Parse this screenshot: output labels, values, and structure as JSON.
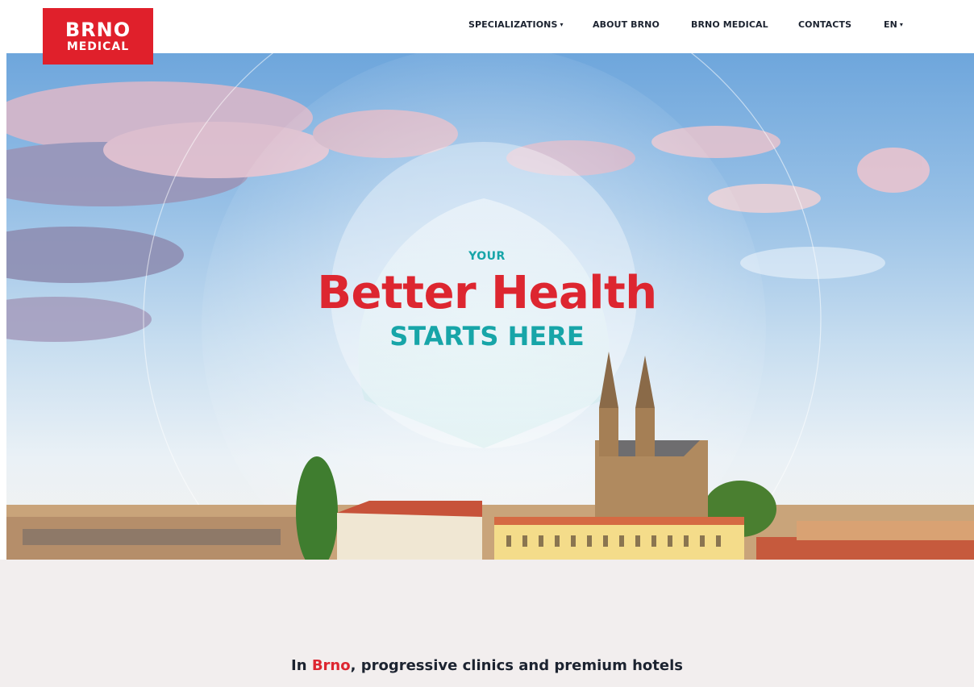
{
  "brand": {
    "logo_line1": "BRNO",
    "logo_line2": "MEDICAL",
    "accent_color": "#dd2630",
    "teal_color": "#17a5a8"
  },
  "nav": {
    "items": [
      {
        "label": "SPECIALIZATIONS",
        "has_dropdown": true
      },
      {
        "label": "ABOUT BRNO",
        "has_dropdown": false
      },
      {
        "label": "BRNO MEDICAL",
        "has_dropdown": false
      },
      {
        "label": "CONTACTS",
        "has_dropdown": false
      },
      {
        "label": "EN",
        "has_dropdown": true
      }
    ],
    "dropdown_icon": "caret-down-icon",
    "caret_glyph": "▾"
  },
  "hero": {
    "kicker": "YOUR",
    "title": "Better Health",
    "subtitle": "STARTS HERE"
  },
  "intro": {
    "prefix": "In ",
    "highlight": "Brno",
    "rest": ", progressive clinics and premium hotels"
  }
}
